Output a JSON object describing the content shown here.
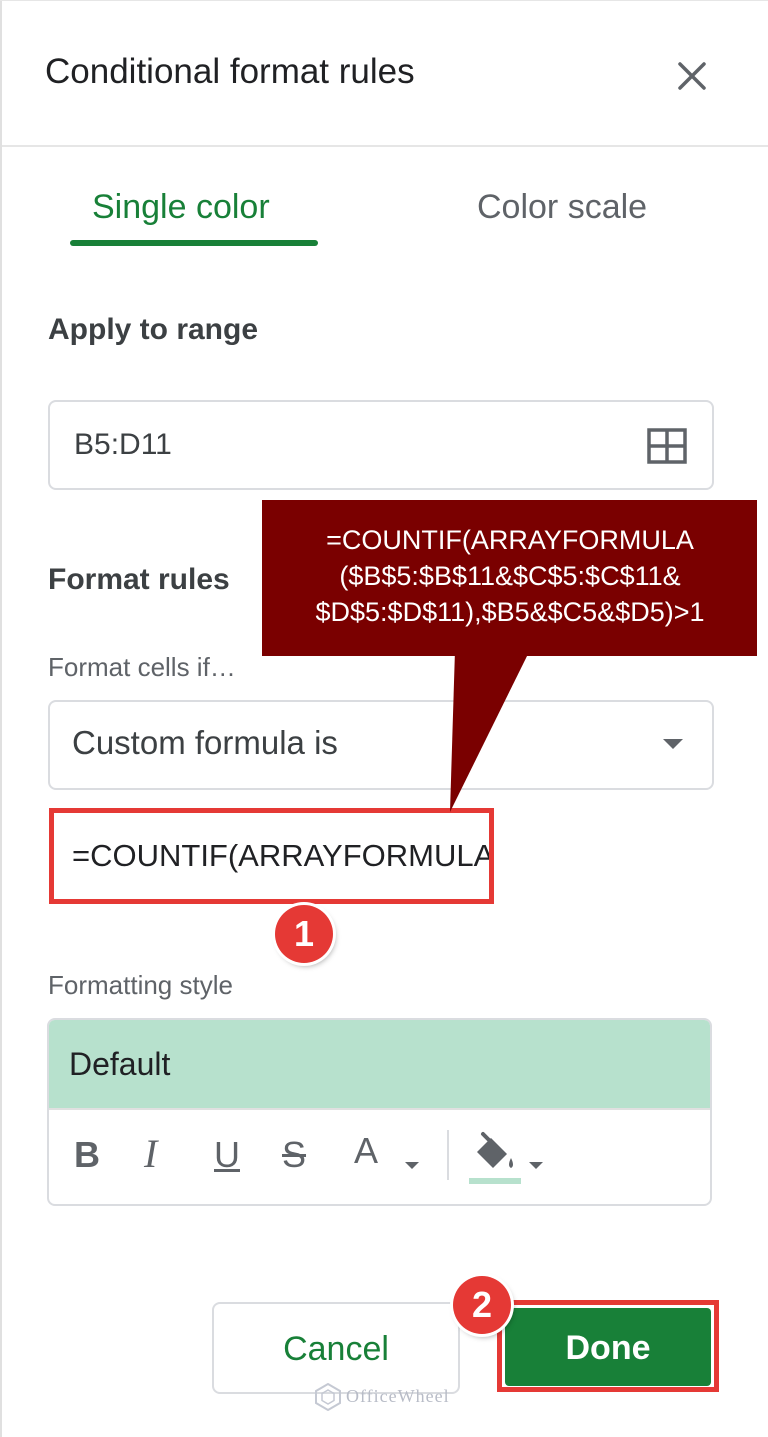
{
  "dialog": {
    "title": "Conditional format rules",
    "close_icon": "close-icon"
  },
  "tabs": [
    {
      "label": "Single color",
      "active": true
    },
    {
      "label": "Color scale",
      "active": false
    }
  ],
  "apply_to_range": {
    "label": "Apply to range",
    "value": "B5:D11",
    "icon": "grid-select-icon"
  },
  "format_rules": {
    "label": "Format rules",
    "condition_label": "Format cells if…",
    "condition_value": "Custom formula is",
    "formula_value": "=COUNTIF(ARRAYFORMULA($B$5:$B$11&$C$5:$C$11&$D$5:$D$11),$B5&$C5&$D5)>1"
  },
  "callout": {
    "text": "=COUNTIF(ARRAYFORMULA\n($B$5:$B$11&$C$5:$C$11&\n$D$5:$D$11),$B5&$C5&$D5)>1"
  },
  "formatting_style": {
    "label": "Formatting style",
    "preview": "Default",
    "tools": {
      "bold": "B",
      "italic": "I",
      "underline": "U",
      "strikethrough": "S",
      "text_color": "A"
    }
  },
  "buttons": {
    "cancel": "Cancel",
    "done": "Done"
  },
  "badges": {
    "step1": "1",
    "step2": "2"
  },
  "watermark": "OfficeWheel",
  "colors": {
    "accent": "#188038",
    "highlight": "#e53935",
    "callout": "#7a0000",
    "preview_fill": "#b7e1cd"
  }
}
